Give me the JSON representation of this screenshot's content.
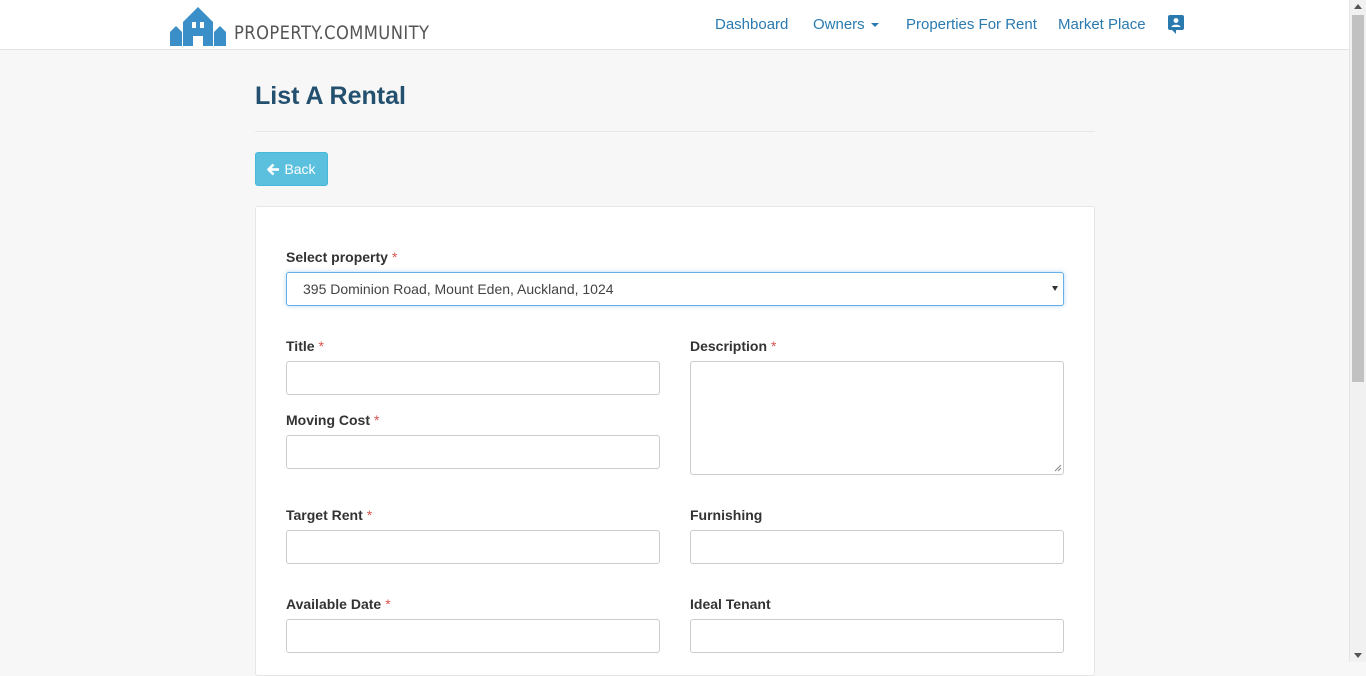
{
  "brand": {
    "name": "PROPERTY.COMMUNITY",
    "color": "#3a8fc8"
  },
  "nav": {
    "items": [
      {
        "label": "Dashboard"
      },
      {
        "label": "Owners"
      },
      {
        "label": "Properties For Rent"
      },
      {
        "label": "Market Place"
      }
    ],
    "profile_icon": "contact-card-icon"
  },
  "page": {
    "title": "List A Rental"
  },
  "back_button": {
    "label": "Back",
    "icon": "arrow-left-icon"
  },
  "form": {
    "required_marker": "*",
    "select_property": {
      "label": "Select property",
      "value": "395 Dominion Road, Mount Eden, Auckland, 1024"
    },
    "title": {
      "label": "Title",
      "value": ""
    },
    "description": {
      "label": "Description",
      "value": ""
    },
    "moving_cost": {
      "label": "Moving Cost",
      "value": ""
    },
    "target_rent": {
      "label": "Target Rent",
      "value": ""
    },
    "furnishing": {
      "label": "Furnishing",
      "value": ""
    },
    "available_date": {
      "label": "Available Date",
      "value": ""
    },
    "ideal_tenant": {
      "label": "Ideal Tenant",
      "value": ""
    }
  },
  "colors": {
    "accent": "#2a7ab0",
    "title": "#24506f",
    "info_button": "#5bc0de",
    "required": "#d9534f"
  }
}
